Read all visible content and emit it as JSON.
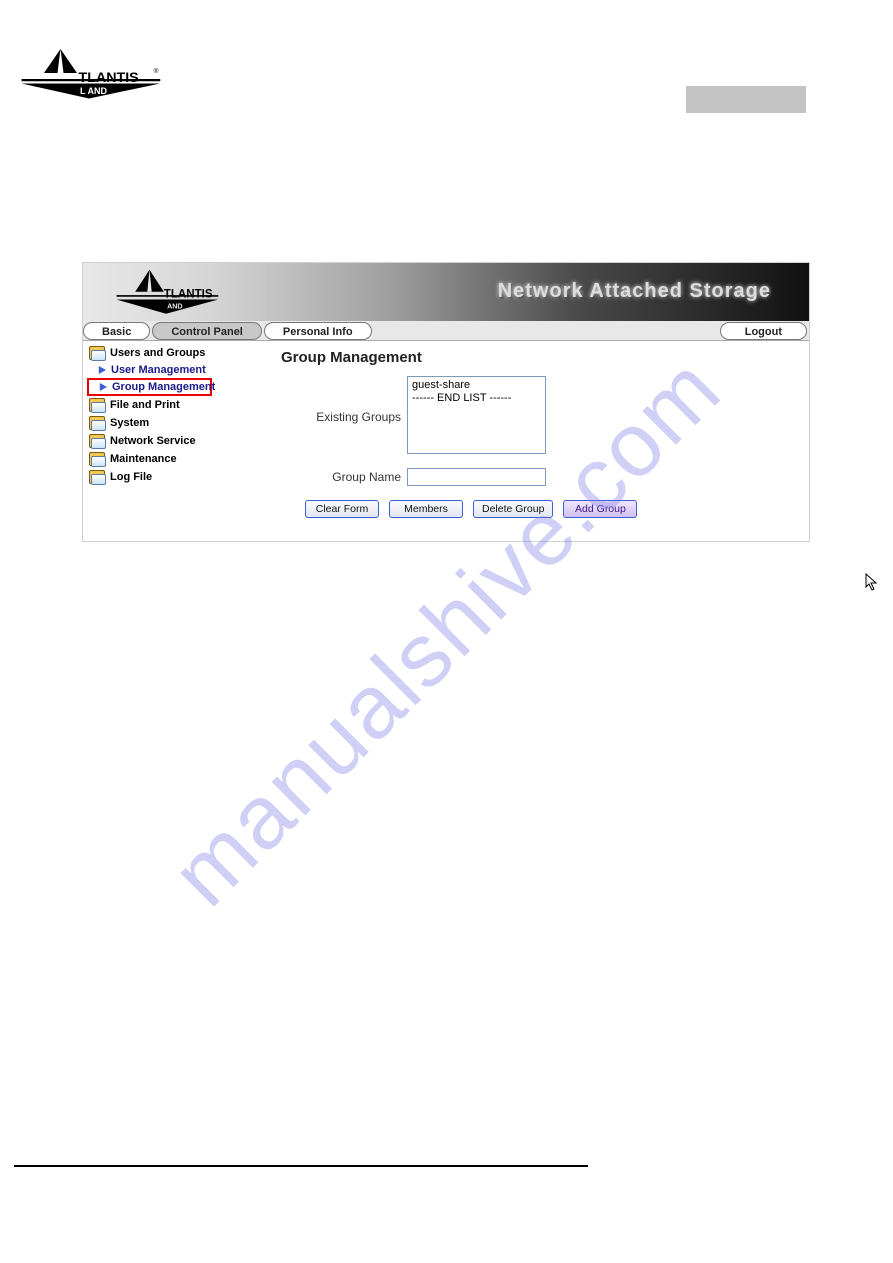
{
  "watermark": "manualshive.com",
  "banner": {
    "title": "Network Attached Storage"
  },
  "tabs": {
    "basic": "Basic",
    "control_panel": "Control Panel",
    "personal_info": "Personal Info",
    "logout": "Logout"
  },
  "sidebar": {
    "users_and_groups": "Users and Groups",
    "user_management": "User Management",
    "group_management": "Group Management",
    "file_and_print": "File and Print",
    "system": "System",
    "network_service": "Network Service",
    "maintenance": "Maintenance",
    "log_file": "Log File"
  },
  "page_title": "Group Management",
  "labels": {
    "existing_groups": "Existing Groups",
    "group_name": "Group Name"
  },
  "existing_groups_list": {
    "0": "guest-share",
    "1": "------ END LIST ------"
  },
  "group_name_value": "",
  "buttons": {
    "clear_form": "Clear Form",
    "members": "Members",
    "delete_group": "Delete Group",
    "add_group": "Add Group"
  }
}
